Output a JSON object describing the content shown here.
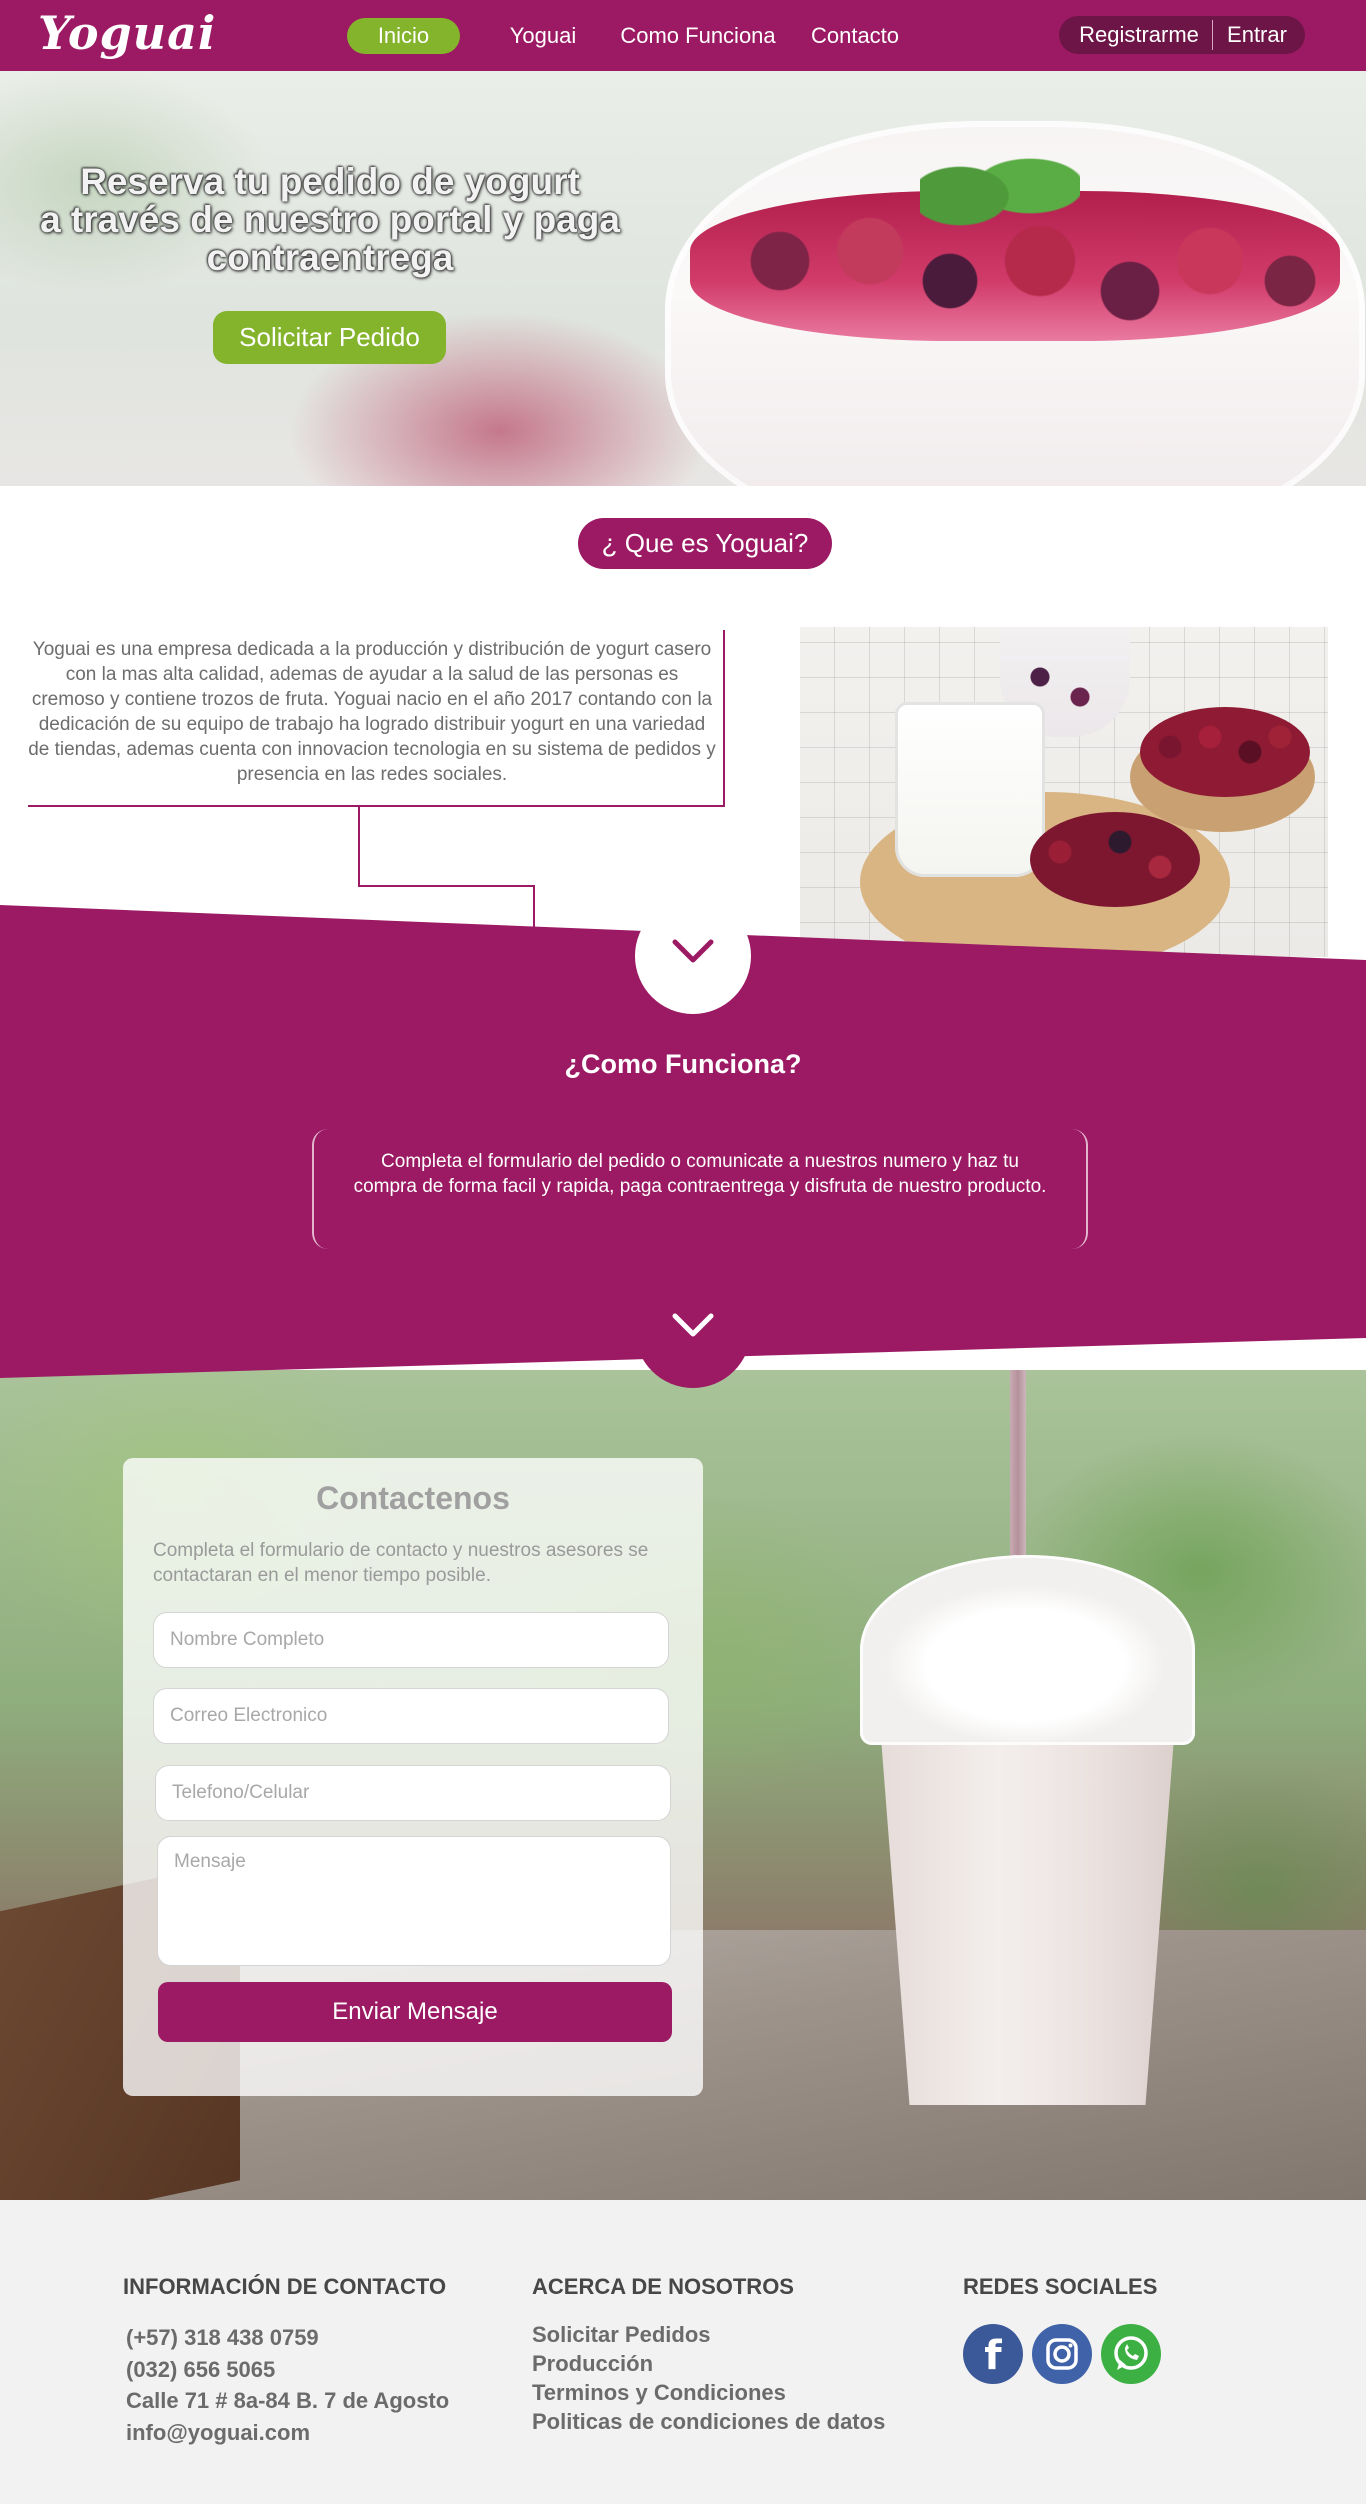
{
  "brand": {
    "logo": "Yoguai"
  },
  "nav": {
    "items": [
      {
        "label": "Inicio",
        "active": true
      },
      {
        "label": "Yoguai"
      },
      {
        "label": "Como Funciona"
      },
      {
        "label": "Contacto"
      }
    ],
    "register_label": "Registrarme",
    "login_label": "Entrar"
  },
  "hero": {
    "title_line1": "Reserva tu pedido de yogurt",
    "title_line2": "a través de nuestro portal y paga",
    "title_line3": "contraentrega",
    "cta_label": "Solicitar Pedido"
  },
  "about": {
    "title": "¿ Que es Yoguai?",
    "body": "Yoguai es una empresa dedicada a la producción y distribución de yogurt casero con la mas alta calidad, ademas de ayudar a la salud de las personas es cremoso y contiene trozos de fruta.  Yoguai nacio en el año 2017 contando con la dedicación de su equipo de trabajo ha logrado distribuir yogurt en una variedad de tiendas, ademas cuenta con innovacion tecnologia en su sistema de pedidos y presencia en las redes sociales."
  },
  "how_it_works": {
    "title": "¿Como Funciona?",
    "body": "Completa el formulario del pedido o comunicate a nuestros numero y haz tu compra de forma facil y rapida, paga contraentrega y disfruta de nuestro producto."
  },
  "contact_form": {
    "title": "Contactenos",
    "description": "Completa el formulario de contacto y nuestros asesores se contactaran en el menor tiempo posible.",
    "name_placeholder": "Nombre Completo",
    "email_placeholder": "Correo Electronico",
    "phone_placeholder": "Telefono/Celular",
    "message_placeholder": "Mensaje",
    "submit_label": "Enviar Mensaje"
  },
  "footer": {
    "contact_heading": "INFORMACIÓN DE CONTACTO",
    "contact_items": [
      "(+57) 318 438 0759",
      "(032) 656 5065",
      "Calle 71 # 8a-84 B. 7 de Agosto",
      "info@yoguai.com"
    ],
    "about_heading": "ACERCA DE NOSOTROS",
    "about_items": [
      "Solicitar Pedidos",
      "Producción",
      "Terminos y Condiciones",
      "Politicas de condiciones de datos"
    ],
    "social_heading": "REDES SOCIALES",
    "social_icons": [
      "facebook-icon",
      "instagram-icon",
      "whatsapp-icon"
    ]
  },
  "colors": {
    "brand_primary": "#9c1a63",
    "accent_green": "#84b32c",
    "footer_bg": "#f2f2f2",
    "facebook": "#3b5998",
    "instagram": "#3f62a8",
    "whatsapp": "#3cb043"
  }
}
